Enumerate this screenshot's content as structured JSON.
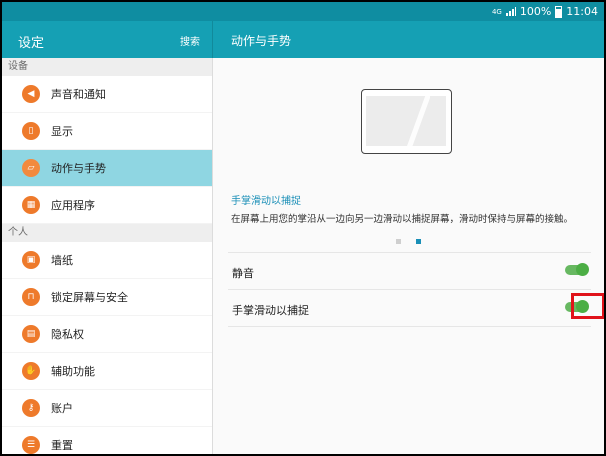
{
  "status": {
    "network": "4G",
    "battery": "100%",
    "time": "11:04"
  },
  "left_header": {
    "title": "设定",
    "search": "搜索"
  },
  "right_header": {
    "title": "动作与手势"
  },
  "sidebar": {
    "sections": [
      {
        "label": "设备",
        "items": [
          {
            "label": "声音和通知",
            "icon": "speaker-icon"
          },
          {
            "label": "显示",
            "icon": "display-icon"
          },
          {
            "label": "动作与手势",
            "icon": "gesture-icon",
            "active": true
          },
          {
            "label": "应用程序",
            "icon": "apps-icon"
          }
        ]
      },
      {
        "label": "个人",
        "items": [
          {
            "label": "墙纸",
            "icon": "wallpaper-icon"
          },
          {
            "label": "锁定屏幕与安全",
            "icon": "lock-icon"
          },
          {
            "label": "隐私权",
            "icon": "privacy-icon"
          },
          {
            "label": "辅助功能",
            "icon": "hand-icon"
          },
          {
            "label": "账户",
            "icon": "key-icon"
          },
          {
            "label": "重置",
            "icon": "reset-icon"
          }
        ]
      }
    ]
  },
  "main": {
    "feature_title": "手掌滑动以捕捉",
    "feature_desc": "在屏幕上用您的掌沿从一边向另一边滑动以捕捉屏幕，滑动时保持与屏幕的接触。",
    "pager": {
      "current": 2,
      "total": 2
    },
    "settings": [
      {
        "label": "静音",
        "enabled": true
      },
      {
        "label": "手掌滑动以捕捉",
        "enabled": true
      }
    ]
  }
}
